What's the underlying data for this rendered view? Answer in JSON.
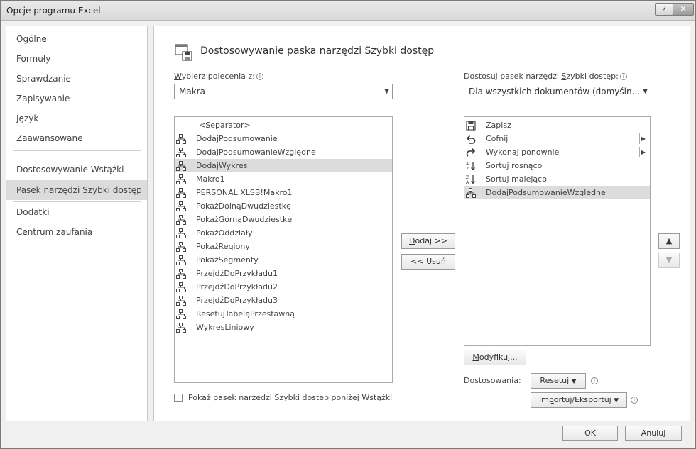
{
  "window": {
    "title": "Opcje programu Excel",
    "help_label": "?",
    "close_label": "✕"
  },
  "sidebar": {
    "items": [
      {
        "label": "Ogólne"
      },
      {
        "label": "Formuły"
      },
      {
        "label": "Sprawdzanie"
      },
      {
        "label": "Zapisywanie"
      },
      {
        "label": "Język"
      },
      {
        "label": "Zaawansowane"
      },
      {
        "label": "Dostosowywanie Wstążki"
      },
      {
        "label": "Pasek narzędzi Szybki dostęp",
        "selected": true
      },
      {
        "label": "Dodatki"
      },
      {
        "label": "Centrum zaufania"
      }
    ]
  },
  "main": {
    "heading": "Dostosowywanie paska narzędzi Szybki dostęp",
    "choose_from": {
      "label_u": "W",
      "label_rest": "ybierz polecenia z:",
      "value": "Makra"
    },
    "customize": {
      "label_pre": "Dostosuj pasek narzędzi ",
      "label_u": "S",
      "label_rest": "zybki dostęp:",
      "value": "Dla wszystkich dokumentów (domyśln..."
    },
    "commands": [
      {
        "label": "<Separator>",
        "icon": "none"
      },
      {
        "label": "DodajPodsumowanie",
        "icon": "macro-icon"
      },
      {
        "label": "DodajPodsumowanieWzględne",
        "icon": "macro-icon"
      },
      {
        "label": "DodajWykres",
        "icon": "macro-icon",
        "selected": true
      },
      {
        "label": "Makro1",
        "icon": "macro-icon"
      },
      {
        "label": "PERSONAL.XLSB!Makro1",
        "icon": "macro-icon"
      },
      {
        "label": "PokażDolnąDwudziestkę",
        "icon": "macro-icon"
      },
      {
        "label": "PokażGórnąDwudziestkę",
        "icon": "macro-icon"
      },
      {
        "label": "PokażOddziały",
        "icon": "macro-icon"
      },
      {
        "label": "PokażRegiony",
        "icon": "macro-icon"
      },
      {
        "label": "PokażSegmenty",
        "icon": "macro-icon"
      },
      {
        "label": "PrzejdźDoPrzykładu1",
        "icon": "macro-icon"
      },
      {
        "label": "PrzejdźDoPrzykładu2",
        "icon": "macro-icon"
      },
      {
        "label": "PrzejdźDoPrzykładu3",
        "icon": "macro-icon"
      },
      {
        "label": "ResetujTabelęPrzestawną",
        "icon": "macro-icon"
      },
      {
        "label": "WykresLiniowy",
        "icon": "macro-icon"
      }
    ],
    "toolbar_items": [
      {
        "label": "Zapisz",
        "icon": "save-icon"
      },
      {
        "label": "Cofnij",
        "icon": "undo-icon",
        "submenu": true
      },
      {
        "label": "Wykonaj ponownie",
        "icon": "redo-icon",
        "submenu": true
      },
      {
        "label": "Sortuj rosnąco",
        "icon": "sort-ascending-icon"
      },
      {
        "label": "Sortuj malejąco",
        "icon": "sort-descending-icon"
      },
      {
        "label": "DodajPodsumowanieWzględne",
        "icon": "macro-icon",
        "selected": true
      }
    ],
    "add_button": {
      "u": "D",
      "rest": "odaj >>"
    },
    "remove_button": {
      "pre": "<< U",
      "u": "s",
      "rest": "uń"
    },
    "move_up_label": "▲",
    "move_down_label": "▼",
    "modify_button": {
      "u": "M",
      "rest": "odyfikuj..."
    },
    "customizations_label": "Dostosowania:",
    "reset_button": {
      "u": "R",
      "rest": "esetuj"
    },
    "import_export_button": {
      "pre": "Im",
      "u": "p",
      "rest": "ortuj/Eksportuj"
    },
    "show_below_ribbon": {
      "u": "P",
      "rest": "okaż pasek narzędzi Szybki dostęp poniżej Wstążki",
      "checked": false
    }
  },
  "footer": {
    "ok_label": "OK",
    "cancel_label": "Anuluj"
  }
}
